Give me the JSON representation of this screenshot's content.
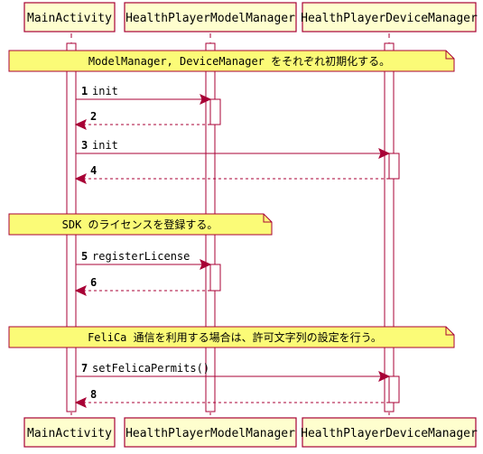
{
  "participants": [
    {
      "id": "main",
      "label": "MainActivity"
    },
    {
      "id": "model",
      "label": "HealthPlayerModelManager"
    },
    {
      "id": "device",
      "label": "HealthPlayerDeviceManager"
    }
  ],
  "notes": [
    {
      "text": "ModelManager, DeviceManager をそれぞれ初期化する。"
    },
    {
      "text": "SDK のライセンスを登録する。"
    },
    {
      "text": "FeliCa 通信を利用する場合は、許可文字列の設定を行う。"
    }
  ],
  "messages": [
    {
      "num": "1",
      "label": "init",
      "from": "main",
      "to": "model",
      "return": false
    },
    {
      "num": "2",
      "label": "",
      "from": "model",
      "to": "main",
      "return": true
    },
    {
      "num": "3",
      "label": "init",
      "from": "main",
      "to": "device",
      "return": false
    },
    {
      "num": "4",
      "label": "",
      "from": "device",
      "to": "main",
      "return": true
    },
    {
      "num": "5",
      "label": "registerLicense",
      "from": "main",
      "to": "model",
      "return": false
    },
    {
      "num": "6",
      "label": "",
      "from": "model",
      "to": "main",
      "return": true
    },
    {
      "num": "7",
      "label": "setFelicaPermits()",
      "from": "main",
      "to": "device",
      "return": false
    },
    {
      "num": "8",
      "label": "",
      "from": "device",
      "to": "main",
      "return": true
    }
  ],
  "colors": {
    "border": "#A80036",
    "participant_fill": "#FEFECE",
    "note_fill": "#FBFB77"
  }
}
